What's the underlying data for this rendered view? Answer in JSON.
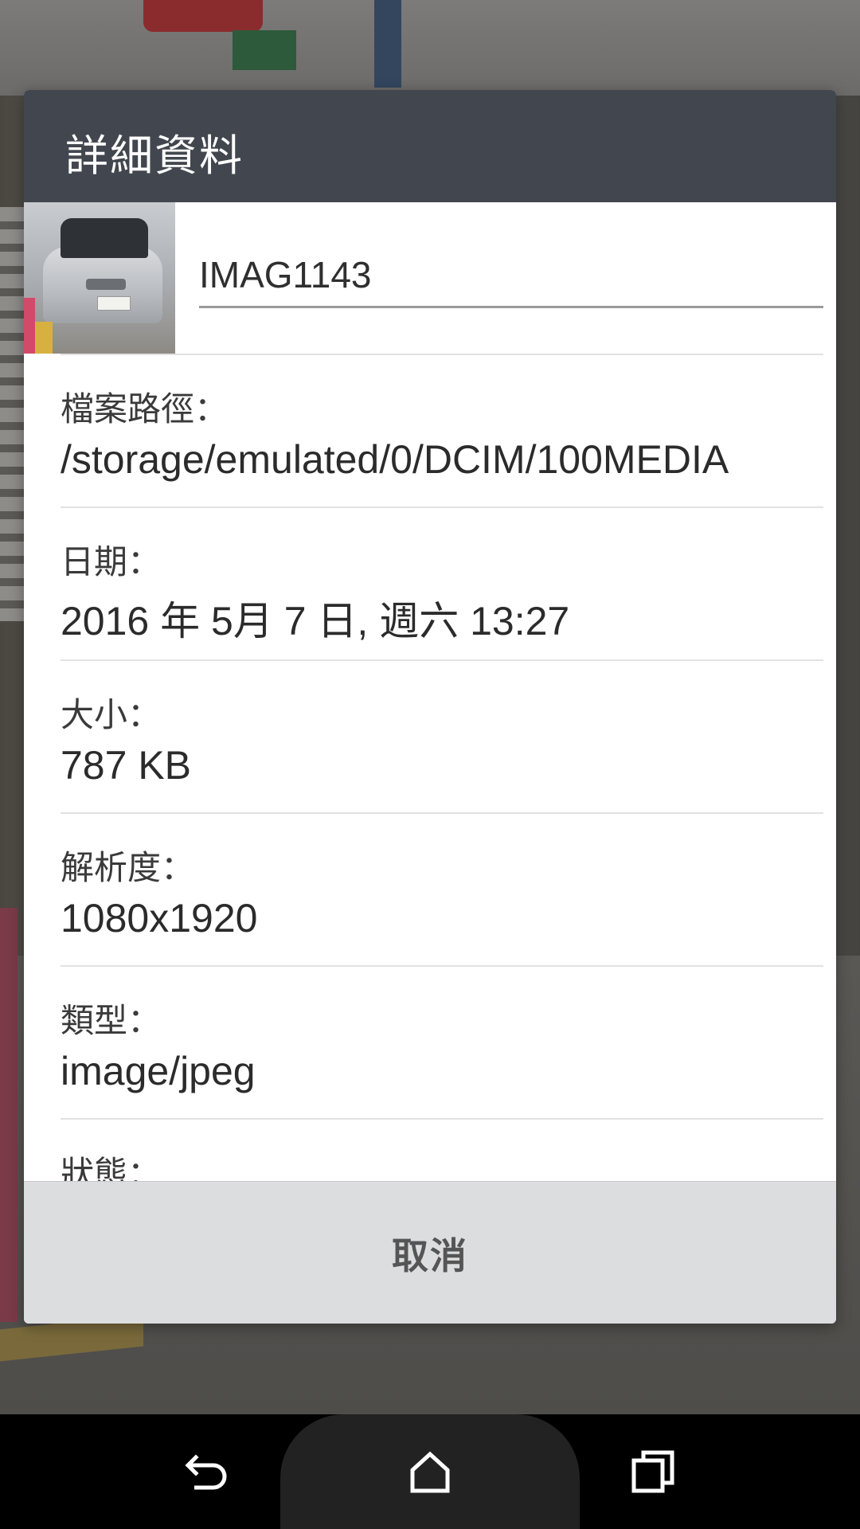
{
  "dialog": {
    "title": "詳細資料",
    "file_name": "IMAG1143",
    "details": [
      {
        "label": "檔案路徑：",
        "value": "/storage/emulated/0/DCIM/100MEDIA"
      },
      {
        "label": "日期：",
        "value": "2016 年 5月 7 日, 週六 13:27"
      },
      {
        "label": "大小：",
        "value": "787 KB"
      },
      {
        "label": "解析度：",
        "value": "1080x1920"
      },
      {
        "label": "類型：",
        "value": "image/jpeg"
      },
      {
        "label": "狀態：",
        "value": ""
      }
    ],
    "cancel_label": "取消"
  },
  "navbar": {
    "back_icon": "back-icon",
    "home_icon": "home-icon",
    "recent_icon": "recent-apps-icon"
  },
  "colors": {
    "header_bg": "#42474f",
    "footer_bg": "#dcdddf",
    "nav_bg": "#000000"
  }
}
